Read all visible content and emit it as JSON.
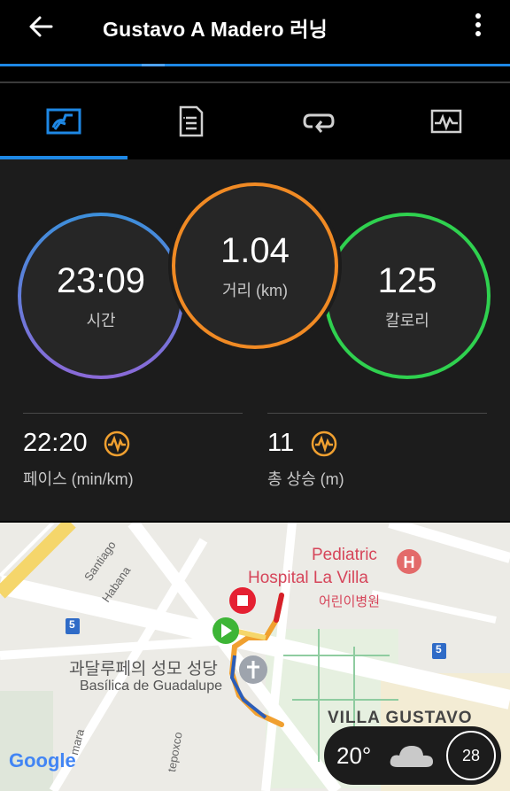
{
  "header": {
    "title": "Gustavo A Madero 러닝",
    "back_icon": "arrow-left-icon",
    "menu_icon": "more-vertical-icon"
  },
  "tabs": [
    {
      "name": "overview",
      "icon": "stats-overview-icon",
      "active": true
    },
    {
      "name": "details",
      "icon": "document-list-icon",
      "active": false
    },
    {
      "name": "laps",
      "icon": "loop-arrow-icon",
      "active": false
    },
    {
      "name": "charts",
      "icon": "pulse-chart-icon",
      "active": false
    }
  ],
  "stats": {
    "time": {
      "value": "23:09",
      "label": "시간"
    },
    "distance": {
      "value": "1.04",
      "label": "거리 (km)"
    },
    "calories": {
      "value": "125",
      "label": "칼로리"
    },
    "pace": {
      "value": "22:20",
      "label": "페이스 (min/km)",
      "icon": "pulse-badge-icon"
    },
    "ascent": {
      "value": "11",
      "label": "총 상승 (m)",
      "icon": "pulse-badge-icon"
    }
  },
  "map": {
    "labels": {
      "hospital_1": "Pediatric",
      "hospital_2": "Hospital La Villa",
      "hospital_kr": "어린이병원",
      "basilica_kr": "과달루페의 성모 성당",
      "basilica": "Basílica de Guadalupe",
      "street_1": "Santiago",
      "street_2": "Habana",
      "street_3": "tepoxco",
      "street_4": "mara",
      "district": "VILLA GUSTAVO",
      "route_5a": "5",
      "route_5b": "5",
      "google": "Google"
    },
    "weather": {
      "temperature": "20°",
      "icon": "cloud-icon",
      "badge": "28"
    }
  },
  "colors": {
    "accent_blue": "#1e88e5",
    "ring_time_top": "#3d8fdb",
    "ring_time_bottom": "#8a6ad8",
    "ring_distance": "#f08a24",
    "ring_calories": "#2fd14f",
    "icon_orange": "#f0a030"
  }
}
